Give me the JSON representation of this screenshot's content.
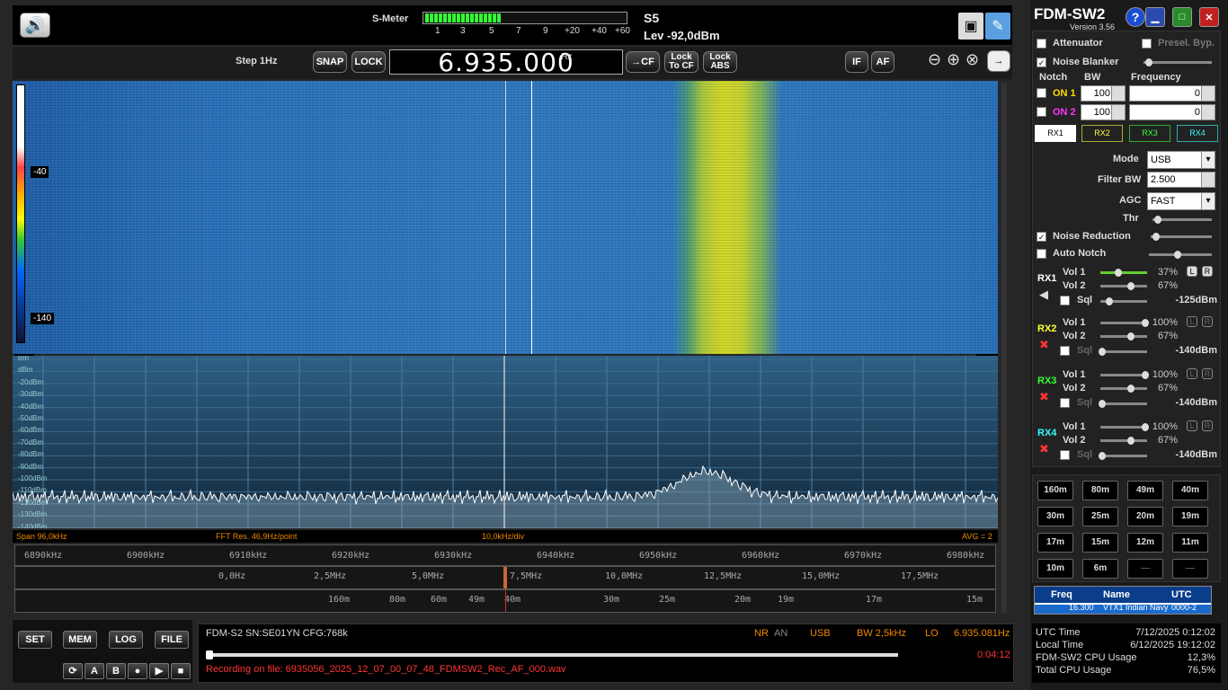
{
  "smeter": {
    "label": "S-Meter",
    "scale": [
      "1",
      "3",
      "5",
      "7",
      "9",
      "+20",
      "+40",
      "+60"
    ],
    "reading": "S5",
    "level": "Lev -92,0dBm",
    "fill": 0.38
  },
  "control": {
    "step": "Step 1Hz",
    "snap": "SNAP",
    "lock": "LOCK",
    "freq": "6.935.000",
    "freq_unit": "Hz",
    "cf": "→CF",
    "lock_cf": "Lock To CF",
    "lock_abs": "Lock ABS",
    "if": "IF",
    "af": "AF"
  },
  "waterfall": {
    "cb_top": "-40",
    "cb_bottom": "-140"
  },
  "spectrum": {
    "db_labels": [
      "Bm",
      "dBm",
      "-20dBm",
      "-30dBm",
      "-40dBm",
      "-50dBm",
      "-60dBm",
      "-70dBm",
      "-80dBm",
      "-90dBm",
      "-100dBm",
      "-110dBm",
      "-120dBm",
      "-130dBm",
      "-140dBm"
    ]
  },
  "footer": {
    "span": "Span 96,0kHz",
    "fft": "FFT Res. 46,9Hz/point",
    "div": "10,0kHz/div",
    "avg": "AVG = 2"
  },
  "freq_axis": [
    "6890kHz",
    "6900kHz",
    "6910kHz",
    "6920kHz",
    "6930kHz",
    "6940kHz",
    "6950kHz",
    "6960kHz",
    "6970kHz",
    "6980kHz"
  ],
  "if_axis": [
    "0,0Hz",
    "2,5MHz",
    "5,0MHz",
    "7,5MHz",
    "10,0MHz",
    "12,5MHz",
    "15,0MHz",
    "17,5MHz"
  ],
  "band_axis": [
    "160m",
    "80m",
    "60m",
    "49m",
    "40m",
    "30m",
    "25m",
    "20m",
    "19m",
    "17m",
    "15m"
  ],
  "bottom_buttons": {
    "set": "SET",
    "mem": "MEM",
    "log": "LOG",
    "file": "FILE",
    "a": "A",
    "b": "B"
  },
  "status": {
    "device": "FDM-S2  SN:SE01YN  CFG:768k",
    "nr": "NR",
    "an": "AN",
    "mode": "USB",
    "bw": "BW 2,5kHz",
    "lo": "LO",
    "lo_freq": "6.935.081Hz",
    "time": "0:04:12",
    "recording": "Recording on file: 6935056_2025_12_07_00_07_48_FDMSW2_Rec_AF_000.wav"
  },
  "app": {
    "title": "FDM-SW2",
    "version": "Version 3.56",
    "help": "?"
  },
  "panel": {
    "attenuator": "Attenuator",
    "presel": "Presel. Byp.",
    "noise_blanker": "Noise Blanker",
    "notch_h": "Notch",
    "bw_h": "BW",
    "freq_h": "Frequency",
    "on1": "ON 1",
    "on2": "ON 2",
    "nbw1": "100",
    "nbw2": "100",
    "nf1": "0",
    "nf2": "0",
    "rx_tabs": [
      "RX1",
      "RX2",
      "RX3",
      "RX4"
    ],
    "mode_l": "Mode",
    "mode": "USB",
    "fbw_l": "Filter BW",
    "fbw": "2.500",
    "agc_l": "AGC",
    "agc": "FAST",
    "thr": "Thr",
    "noise_reduction": "Noise Reduction",
    "auto_notch": "Auto Notch",
    "rx": [
      {
        "name": "RX1",
        "color": "#ffffff",
        "v1": "37%",
        "v2": "67%",
        "sql": "-125dBm",
        "v1f": 0.37
      },
      {
        "name": "RX2",
        "color": "#ffff33",
        "v1": "100%",
        "v2": "67%",
        "sql": "-140dBm",
        "v1f": 1.0
      },
      {
        "name": "RX3",
        "color": "#33ff33",
        "v1": "100%",
        "v2": "67%",
        "sql": "-140dBm",
        "v1f": 1.0
      },
      {
        "name": "RX4",
        "color": "#33ffff",
        "v1": "100%",
        "v2": "67%",
        "sql": "-140dBm",
        "v1f": 1.0
      }
    ],
    "vol1": "Vol 1",
    "vol2": "Vol 2",
    "sql_l": "Sql",
    "l": "L",
    "r": "R"
  },
  "bands": [
    "160m",
    "80m",
    "49m",
    "40m",
    "30m",
    "25m",
    "20m",
    "19m",
    "17m",
    "15m",
    "12m",
    "11m",
    "10m",
    "6m",
    "—",
    "—"
  ],
  "list": {
    "freq_h": "Freq",
    "name_h": "Name",
    "utc_h": "UTC",
    "row_freq": "16.300",
    "row_name": "VTX1 Indian Navy",
    "row_utc": "0000-2"
  },
  "info": {
    "utc_l": "UTC Time",
    "utc": "7/12/2025 0:12:02",
    "local_l": "Local Time",
    "local": "6/12/2025 19:12:02",
    "cpu_l": "FDM-SW2 CPU Usage",
    "cpu": "12,3%",
    "tcpu_l": "Total CPU Usage",
    "tcpu": "76,5%"
  }
}
